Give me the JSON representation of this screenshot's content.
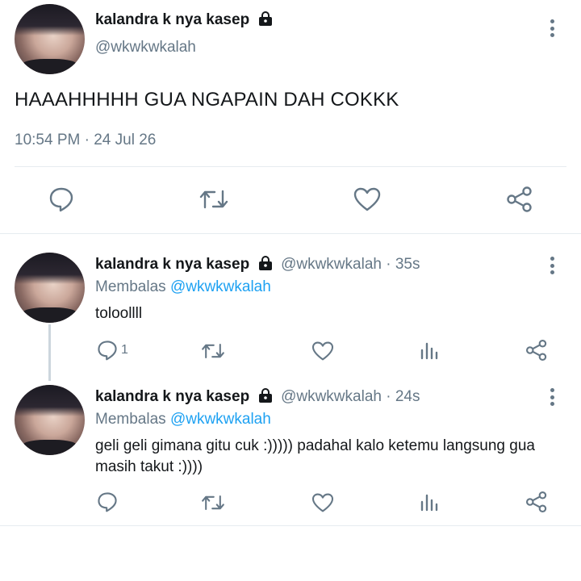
{
  "main_tweet": {
    "name": "kalandra k nya kasep",
    "handle": "@wkwkwkalah",
    "text": "HAAAHHHHH GUA NGAPAIN DAH COKKK",
    "timestamp": "10:54 PM · 24 Jul 26"
  },
  "replies": [
    {
      "name": "kalandra k nya kasep",
      "handle_time": "@wkwkwkalah · 35s",
      "replying_prefix": "Membalas",
      "replying_to": "@wkwkwkalah",
      "text": "toloollll",
      "reply_count": "1"
    },
    {
      "name": "kalandra k nya kasep",
      "handle_time": "@wkwkwkalah · 24s",
      "replying_prefix": "Membalas",
      "replying_to": "@wkwkwkalah",
      "text_line1": "geli geli gimana gitu cuk :))))) padahal kalo ketemu langsung gua",
      "text_line2": "masih takut :))))",
      "reply_count": ""
    }
  ],
  "icons": [
    "reply-icon",
    "retweet-icon",
    "like-icon",
    "share-icon",
    "analytics-icon",
    "lock-icon",
    "more-icon"
  ],
  "colors": {
    "text": "#14171a",
    "secondary": "#657786",
    "link": "#1da1f2",
    "divider": "#e6ecf0"
  }
}
